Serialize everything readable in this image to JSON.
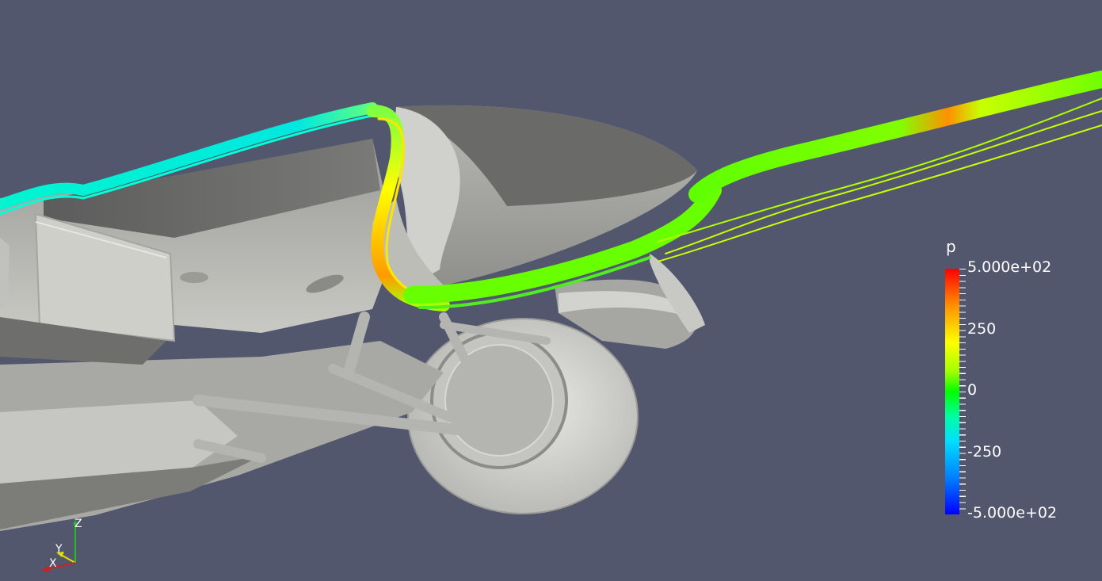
{
  "legend": {
    "title": "p",
    "labels": [
      "5.000e+02",
      "250",
      "0",
      "-250",
      "-5.000e+02"
    ]
  },
  "axes": {
    "z": "Z",
    "y": "Y",
    "x": "X"
  },
  "colors": {
    "background": "#52576e",
    "surface": "#c8c8c4",
    "axis_x": "#d02020",
    "axis_y": "#e0e000",
    "axis_z": "#20c020"
  }
}
